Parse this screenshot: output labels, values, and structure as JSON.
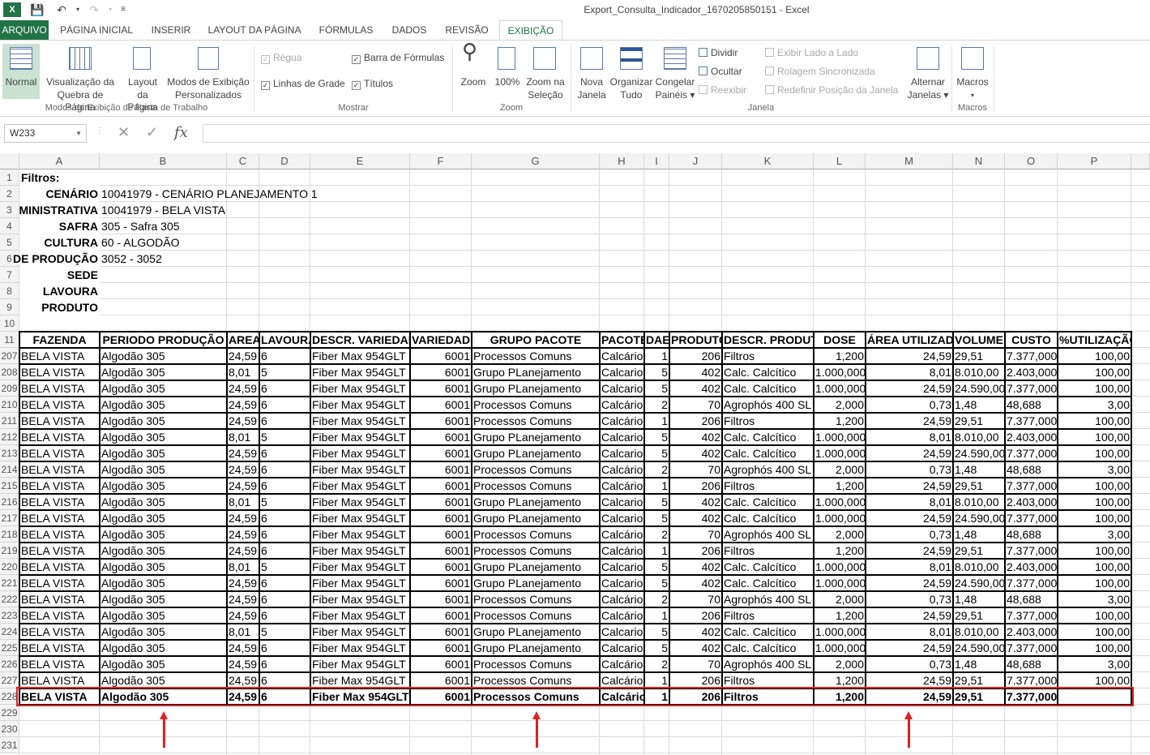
{
  "window": {
    "title": "Export_Consulta_Indicador_1670205850151 - Excel"
  },
  "tabs": [
    "ARQUIVO",
    "PÁGINA INICIAL",
    "INSERIR",
    "LAYOUT DA PÁGINA",
    "FÓRMULAS",
    "DADOS",
    "REVISÃO",
    "EXIBIÇÃO"
  ],
  "ribbon": {
    "views": {
      "normal": "Normal",
      "pagebreak": [
        "Visualização da",
        "Quebra de Página"
      ],
      "pagelayout": [
        "Layout",
        "da Página"
      ],
      "custom": [
        "Modos de Exibição",
        "Personalizados"
      ],
      "group": "Modos de Exibição de Pasta de Trabalho"
    },
    "show": {
      "ruler": "Régua",
      "formula_bar": "Barra de Fórmulas",
      "gridlines": "Linhas de Grade",
      "headings": "Títulos",
      "group": "Mostrar"
    },
    "zoom": {
      "zoom": "Zoom",
      "zoom100": "100%",
      "selection": [
        "Zoom na",
        "Seleção"
      ],
      "group": "Zoom"
    },
    "window": {
      "new": [
        "Nova",
        "Janela"
      ],
      "arrange": [
        "Organizar",
        "Tudo"
      ],
      "freeze": [
        "Congelar",
        "Painéis ▾"
      ],
      "split": "Dividir",
      "hide": "Ocultar",
      "unhide": "Reexibir",
      "side": "Exibir Lado a Lado",
      "sync": "Rolagem Sincronizada",
      "reset": "Redefinir Posição da Janela",
      "switch": [
        "Alternar",
        "Janelas ▾"
      ],
      "group": "Janela"
    },
    "macros": {
      "label": "Macros",
      "group": "Macros"
    }
  },
  "formula_bar": {
    "name_box": "W233",
    "fx": "fx",
    "value": ""
  },
  "sheet": {
    "columns": [
      "A",
      "B",
      "C",
      "D",
      "E",
      "F",
      "G",
      "H",
      "I",
      "J",
      "K",
      "L",
      "M",
      "N",
      "O",
      "P"
    ],
    "filters": [
      {
        "row": "1",
        "label": "Filtros:",
        "value": ""
      },
      {
        "row": "2",
        "label": "CENÁRIO",
        "value": "10041979 - CENÁRIO PLANEJAMENTO 1"
      },
      {
        "row": "3",
        "label": "MINISTRATIVA",
        "value": "10041979 - BELA VISTA"
      },
      {
        "row": "4",
        "label": "SAFRA",
        "value": "305 - Safra 305"
      },
      {
        "row": "5",
        "label": "CULTURA",
        "value": "60 - ALGODÃO"
      },
      {
        "row": "6",
        "label": "DE PRODUÇÃO",
        "value": "3052 - 3052"
      },
      {
        "row": "7",
        "label": "SEDE",
        "value": ""
      },
      {
        "row": "8",
        "label": "LAVOURA",
        "value": ""
      },
      {
        "row": "9",
        "label": "PRODUTO",
        "value": ""
      },
      {
        "row": "10",
        "label": "",
        "value": ""
      }
    ],
    "header_row": "11",
    "headers": [
      "FAZENDA",
      "PERIODO PRODUÇÃO",
      "AREA",
      "LAVOURA",
      "DESCR. VARIEDADE",
      "VARIEDADE",
      "GRUPO PACOTE",
      "PACOTE",
      "DAE",
      "PRODUTO",
      "DESCR. PRODUTO",
      "DOSE",
      "ÁREA UTILIZADA",
      "VOLUME",
      "CUSTO",
      "%UTILIZAÇÃO"
    ],
    "rows": [
      {
        "n": "207",
        "cells": [
          "BELA VISTA",
          "Algodão 305",
          "24,59",
          "6",
          "Fiber Max 954GLT",
          "6001",
          "Processos Comuns",
          "Calcário",
          "1",
          "206",
          "Filtros",
          "1,200",
          "24,59",
          "29,51",
          "7.377,000",
          "100,00"
        ]
      },
      {
        "n": "208",
        "cells": [
          "BELA VISTA",
          "Algodão 305",
          "8,01",
          "5",
          "Fiber Max 954GLT",
          "6001",
          "Grupo PLanejamento",
          "Calcario",
          "5",
          "402",
          "Calc. Calcítico",
          "1.000,000",
          "8,01",
          "8.010,00",
          "2.403,000",
          "100,00"
        ]
      },
      {
        "n": "209",
        "cells": [
          "BELA VISTA",
          "Algodão 305",
          "24,59",
          "6",
          "Fiber Max 954GLT",
          "6001",
          "Grupo PLanejamento",
          "Calcario",
          "5",
          "402",
          "Calc. Calcítico",
          "1.000,000",
          "24,59",
          "24.590,00",
          "7.377,000",
          "100,00"
        ]
      },
      {
        "n": "210",
        "cells": [
          "BELA VISTA",
          "Algodão 305",
          "24,59",
          "6",
          "Fiber Max 954GLT",
          "6001",
          "Processos Comuns",
          "Calcário",
          "2",
          "70",
          "Agrophós 400 SL",
          "2,000",
          "0,73",
          "1,48",
          "48,688",
          "3,00"
        ]
      },
      {
        "n": "211",
        "cells": [
          "BELA VISTA",
          "Algodão 305",
          "24,59",
          "6",
          "Fiber Max 954GLT",
          "6001",
          "Processos Comuns",
          "Calcário",
          "1",
          "206",
          "Filtros",
          "1,200",
          "24,59",
          "29,51",
          "7.377,000",
          "100,00"
        ]
      },
      {
        "n": "212",
        "cells": [
          "BELA VISTA",
          "Algodão 305",
          "8,01",
          "5",
          "Fiber Max 954GLT",
          "6001",
          "Grupo PLanejamento",
          "Calcario",
          "5",
          "402",
          "Calc. Calcítico",
          "1.000,000",
          "8,01",
          "8.010,00",
          "2.403,000",
          "100,00"
        ]
      },
      {
        "n": "213",
        "cells": [
          "BELA VISTA",
          "Algodão 305",
          "24,59",
          "6",
          "Fiber Max 954GLT",
          "6001",
          "Grupo PLanejamento",
          "Calcario",
          "5",
          "402",
          "Calc. Calcítico",
          "1.000,000",
          "24,59",
          "24.590,00",
          "7.377,000",
          "100,00"
        ]
      },
      {
        "n": "214",
        "cells": [
          "BELA VISTA",
          "Algodão 305",
          "24,59",
          "6",
          "Fiber Max 954GLT",
          "6001",
          "Processos Comuns",
          "Calcário",
          "2",
          "70",
          "Agrophós 400 SL",
          "2,000",
          "0,73",
          "1,48",
          "48,688",
          "3,00"
        ]
      },
      {
        "n": "215",
        "cells": [
          "BELA VISTA",
          "Algodão 305",
          "24,59",
          "6",
          "Fiber Max 954GLT",
          "6001",
          "Processos Comuns",
          "Calcário",
          "1",
          "206",
          "Filtros",
          "1,200",
          "24,59",
          "29,51",
          "7.377,000",
          "100,00"
        ]
      },
      {
        "n": "216",
        "cells": [
          "BELA VISTA",
          "Algodão 305",
          "8,01",
          "5",
          "Fiber Max 954GLT",
          "6001",
          "Grupo PLanejamento",
          "Calcario",
          "5",
          "402",
          "Calc. Calcítico",
          "1.000,000",
          "8,01",
          "8.010,00",
          "2.403,000",
          "100,00"
        ]
      },
      {
        "n": "217",
        "cells": [
          "BELA VISTA",
          "Algodão 305",
          "24,59",
          "6",
          "Fiber Max 954GLT",
          "6001",
          "Grupo PLanejamento",
          "Calcario",
          "5",
          "402",
          "Calc. Calcítico",
          "1.000,000",
          "24,59",
          "24.590,00",
          "7.377,000",
          "100,00"
        ]
      },
      {
        "n": "218",
        "cells": [
          "BELA VISTA",
          "Algodão 305",
          "24,59",
          "6",
          "Fiber Max 954GLT",
          "6001",
          "Processos Comuns",
          "Calcário",
          "2",
          "70",
          "Agrophós 400 SL",
          "2,000",
          "0,73",
          "1,48",
          "48,688",
          "3,00"
        ]
      },
      {
        "n": "219",
        "cells": [
          "BELA VISTA",
          "Algodão 305",
          "24,59",
          "6",
          "Fiber Max 954GLT",
          "6001",
          "Processos Comuns",
          "Calcário",
          "1",
          "206",
          "Filtros",
          "1,200",
          "24,59",
          "29,51",
          "7.377,000",
          "100,00"
        ]
      },
      {
        "n": "220",
        "cells": [
          "BELA VISTA",
          "Algodão 305",
          "8,01",
          "5",
          "Fiber Max 954GLT",
          "6001",
          "Grupo PLanejamento",
          "Calcario",
          "5",
          "402",
          "Calc. Calcítico",
          "1.000,000",
          "8,01",
          "8.010,00",
          "2.403,000",
          "100,00"
        ]
      },
      {
        "n": "221",
        "cells": [
          "BELA VISTA",
          "Algodão 305",
          "24,59",
          "6",
          "Fiber Max 954GLT",
          "6001",
          "Grupo PLanejamento",
          "Calcario",
          "5",
          "402",
          "Calc. Calcítico",
          "1.000,000",
          "24,59",
          "24.590,00",
          "7.377,000",
          "100,00"
        ]
      },
      {
        "n": "222",
        "cells": [
          "BELA VISTA",
          "Algodão 305",
          "24,59",
          "6",
          "Fiber Max 954GLT",
          "6001",
          "Processos Comuns",
          "Calcário",
          "2",
          "70",
          "Agrophós 400 SL",
          "2,000",
          "0,73",
          "1,48",
          "48,688",
          "3,00"
        ]
      },
      {
        "n": "223",
        "cells": [
          "BELA VISTA",
          "Algodão 305",
          "24,59",
          "6",
          "Fiber Max 954GLT",
          "6001",
          "Processos Comuns",
          "Calcário",
          "1",
          "206",
          "Filtros",
          "1,200",
          "24,59",
          "29,51",
          "7.377,000",
          "100,00"
        ]
      },
      {
        "n": "224",
        "cells": [
          "BELA VISTA",
          "Algodão 305",
          "8,01",
          "5",
          "Fiber Max 954GLT",
          "6001",
          "Grupo PLanejamento",
          "Calcario",
          "5",
          "402",
          "Calc. Calcítico",
          "1.000,000",
          "8,01",
          "8.010,00",
          "2.403,000",
          "100,00"
        ]
      },
      {
        "n": "225",
        "cells": [
          "BELA VISTA",
          "Algodão 305",
          "24,59",
          "6",
          "Fiber Max 954GLT",
          "6001",
          "Grupo PLanejamento",
          "Calcario",
          "5",
          "402",
          "Calc. Calcítico",
          "1.000,000",
          "24,59",
          "24.590,00",
          "7.377,000",
          "100,00"
        ]
      },
      {
        "n": "226",
        "cells": [
          "BELA VISTA",
          "Algodão 305",
          "24,59",
          "6",
          "Fiber Max 954GLT",
          "6001",
          "Processos Comuns",
          "Calcário",
          "2",
          "70",
          "Agrophós 400 SL",
          "2,000",
          "0,73",
          "1,48",
          "48,688",
          "3,00"
        ]
      },
      {
        "n": "227",
        "cells": [
          "BELA VISTA",
          "Algodão 305",
          "24,59",
          "6",
          "Fiber Max 954GLT",
          "6001",
          "Processos Comuns",
          "Calcário",
          "1",
          "206",
          "Filtros",
          "1,200",
          "24,59",
          "29,51",
          "7.377,000",
          "100,00"
        ]
      },
      {
        "n": "228",
        "cells": [
          "BELA VISTA",
          "Algodão 305",
          "24,59",
          "6",
          "Fiber Max 954GLT",
          "6001",
          "Processos Comuns",
          "Calcário",
          "1",
          "206",
          "Filtros",
          "1,200",
          "24,59",
          "29,51",
          "7.377,000",
          ""
        ],
        "bold": true
      }
    ],
    "trailing_rows": [
      "229",
      "230",
      "231"
    ]
  },
  "colors": {
    "accent": "#217346",
    "highlight": "#e02020"
  }
}
